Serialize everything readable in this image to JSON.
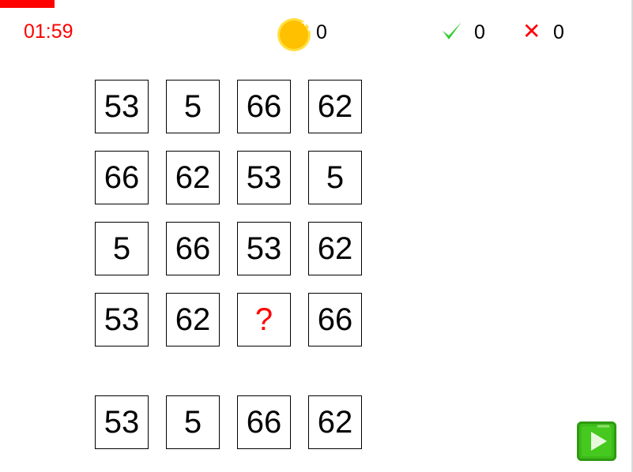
{
  "status": {
    "timer": "01:59",
    "coins": "0",
    "correct": "0",
    "wrong": "0",
    "progress_fraction": 0.086
  },
  "icons": {
    "coin": "coin-icon",
    "correct": "checkmark-icon",
    "wrong": "cross-icon",
    "next": "play-arrow-icon"
  },
  "colors": {
    "accent_red": "#ff0000",
    "coin_yellow": "#ffc000",
    "check_green": "#33cc33",
    "button_green": "#3dbb1a"
  },
  "grid": {
    "rows": [
      [
        "53",
        "5",
        "66",
        "62"
      ],
      [
        "66",
        "62",
        "53",
        "5"
      ],
      [
        "5",
        "66",
        "53",
        "62"
      ],
      [
        "53",
        "62",
        "?",
        "66"
      ]
    ]
  },
  "options": [
    "53",
    "5",
    "66",
    "62"
  ]
}
